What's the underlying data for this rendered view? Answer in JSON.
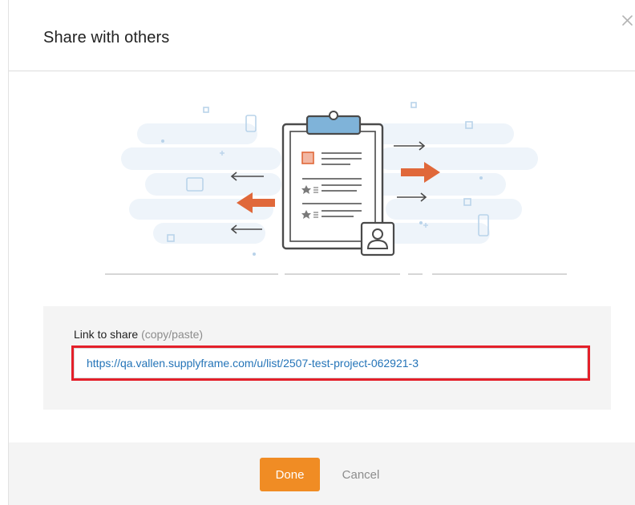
{
  "dialog": {
    "title": "Share with others"
  },
  "link": {
    "label": "Link to share",
    "hint": "(copy/paste)",
    "url": "https://qa.vallen.supplyframe.com/u/list/2507-test-project-062921-3"
  },
  "footer": {
    "done_label": "Done",
    "cancel_label": "Cancel"
  },
  "colors": {
    "accent": "#f08c24",
    "arrow": "#e0683a",
    "link": "#2474b8",
    "highlight": "#e4202a",
    "clipboard_clip": "#7fb3d9"
  },
  "icons": {
    "close": "close-icon",
    "illustration": "clipboard-share-illustration",
    "user": "user-icon",
    "star": "star-icon"
  }
}
